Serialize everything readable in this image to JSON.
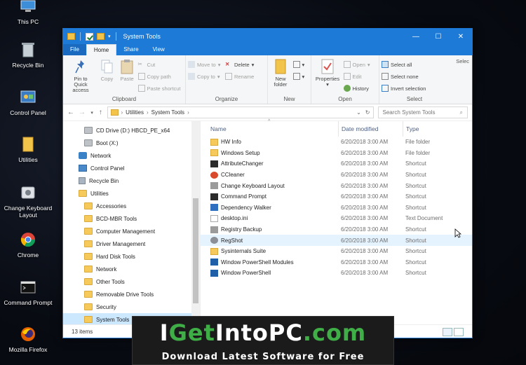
{
  "desktop": {
    "icons": [
      {
        "label": "This PC",
        "icon": "computer-icon"
      },
      {
        "label": "Recycle Bin",
        "icon": "recycle-bin-icon"
      },
      {
        "label": "Control Panel",
        "icon": "control-panel-icon"
      },
      {
        "label": "Utilities",
        "icon": "folder-icon"
      },
      {
        "label": "Change Keyboard Layout",
        "icon": "keyboard-icon"
      },
      {
        "label": "Chrome",
        "icon": "chrome-icon"
      },
      {
        "label": "Command Prompt",
        "icon": "cmd-icon"
      },
      {
        "label": "Mozilla Firefox",
        "icon": "firefox-icon"
      }
    ]
  },
  "window": {
    "title": "System Tools",
    "accent": "#1d7ad6",
    "controls": {
      "minimize": "—",
      "maximize": "☐",
      "close": "✕"
    }
  },
  "tabs": [
    "File",
    "Home",
    "Share",
    "View"
  ],
  "ribbon": {
    "clipboard": {
      "group": "Clipboard",
      "pin": "Pin to Quick access",
      "copy": "Copy",
      "paste": "Paste",
      "cut": "Cut",
      "copy_path": "Copy path",
      "paste_shortcut": "Paste shortcut"
    },
    "organize": {
      "group": "Organize",
      "move_to": "Move to",
      "copy_to": "Copy to",
      "delete": "Delete",
      "rename": "Rename"
    },
    "new": {
      "group": "New",
      "new_folder": "New folder"
    },
    "open": {
      "group": "Open",
      "properties": "Properties",
      "open": "Open",
      "edit": "Edit",
      "history": "History"
    },
    "select": {
      "group": "Select",
      "select_all": "Select all",
      "select_none": "Select none",
      "invert": "Invert selection",
      "partial": "Selec"
    }
  },
  "address": {
    "crumbs": [
      "Utilities",
      "System Tools"
    ],
    "search_placeholder": "Search System Tools"
  },
  "nav_items": [
    {
      "label": "CD Drive (D:) HBCD_PE_x64",
      "type": "drive"
    },
    {
      "label": "Boot (X:)",
      "type": "drive"
    },
    {
      "label": "Network",
      "type": "net"
    },
    {
      "label": "Control Panel",
      "type": "cp"
    },
    {
      "label": "Recycle Bin",
      "type": "rb"
    },
    {
      "label": "Utilities",
      "type": "folder"
    },
    {
      "label": "Accessories",
      "type": "folder"
    },
    {
      "label": "BCD-MBR Tools",
      "type": "folder"
    },
    {
      "label": "Computer Management",
      "type": "folder"
    },
    {
      "label": "Driver Management",
      "type": "folder"
    },
    {
      "label": "Hard Disk Tools",
      "type": "folder"
    },
    {
      "label": "Network",
      "type": "folder"
    },
    {
      "label": "Other Tools",
      "type": "folder"
    },
    {
      "label": "Removable Drive Tools",
      "type": "folder"
    },
    {
      "label": "Security",
      "type": "folder"
    },
    {
      "label": "System Tools",
      "type": "folder",
      "selected": true
    }
  ],
  "files": {
    "columns": [
      "Name",
      "Date modified",
      "Type"
    ],
    "rows": [
      {
        "name": "HW Info",
        "date": "6/20/2018 3:00 AM",
        "type": "File folder",
        "icon": "folder"
      },
      {
        "name": "Windows Setup",
        "date": "6/20/2018 3:00 AM",
        "type": "File folder",
        "icon": "folder"
      },
      {
        "name": "AttributeChanger",
        "date": "6/20/2018 3:00 AM",
        "type": "Shortcut",
        "icon": "dark"
      },
      {
        "name": "CCleaner",
        "date": "6/20/2018 3:00 AM",
        "type": "Shortcut",
        "icon": "cc"
      },
      {
        "name": "Change Keyboard Layout",
        "date": "6/20/2018 3:00 AM",
        "type": "Shortcut",
        "icon": "gray"
      },
      {
        "name": "Command Prompt",
        "date": "6/20/2018 3:00 AM",
        "type": "Shortcut",
        "icon": "dark"
      },
      {
        "name": "Dependency Walker",
        "date": "6/20/2018 3:00 AM",
        "type": "Shortcut",
        "icon": "blue"
      },
      {
        "name": "desktop.ini",
        "date": "6/20/2018 3:00 AM",
        "type": "Text Document",
        "icon": "doc"
      },
      {
        "name": "Registry Backup",
        "date": "6/20/2018 3:00 AM",
        "type": "Shortcut",
        "icon": "gray"
      },
      {
        "name": "RegShot",
        "date": "6/20/2018 3:00 AM",
        "type": "Shortcut",
        "icon": "gear",
        "hover": true
      },
      {
        "name": "Sysinternals Suite",
        "date": "6/20/2018 3:00 AM",
        "type": "Shortcut",
        "icon": "folder"
      },
      {
        "name": "Window PowerShell Modules",
        "date": "6/20/2018 3:00 AM",
        "type": "Shortcut",
        "icon": "ps"
      },
      {
        "name": "Window PowerShell",
        "date": "6/20/2018 3:00 AM",
        "type": "Shortcut",
        "icon": "ps"
      }
    ]
  },
  "status": {
    "count": "13 items"
  },
  "banner": {
    "brand_parts": [
      "I",
      "Get",
      "Into",
      "PC",
      ".com"
    ],
    "tagline": "Download Latest Software for Free"
  }
}
